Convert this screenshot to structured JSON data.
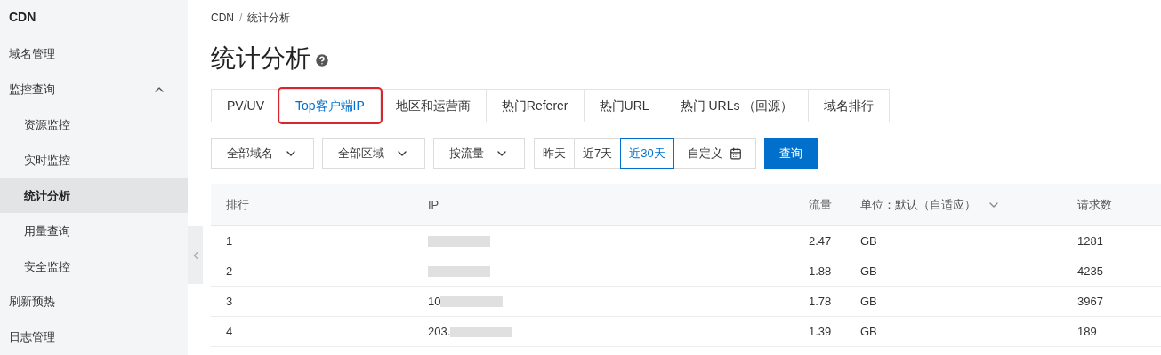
{
  "sidebar": {
    "title": "CDN",
    "items": [
      {
        "label": "域名管理",
        "selected": false
      },
      {
        "label": "监控查询",
        "selected": false,
        "expanded": true,
        "children": [
          {
            "label": "资源监控",
            "selected": false
          },
          {
            "label": "实时监控",
            "selected": false
          },
          {
            "label": "统计分析",
            "selected": true
          },
          {
            "label": "用量查询",
            "selected": false
          },
          {
            "label": "安全监控",
            "selected": false
          }
        ]
      },
      {
        "label": "刷新预热",
        "selected": false
      },
      {
        "label": "日志管理",
        "selected": false
      }
    ]
  },
  "breadcrumb": [
    "CDN",
    "统计分析"
  ],
  "breadcrumb_separator": "/",
  "page_title": "统计分析",
  "tabs": [
    {
      "label": "PV/UV",
      "selected": false,
      "highlighted": false
    },
    {
      "label": "Top客户端IP",
      "selected": true,
      "highlighted": true
    },
    {
      "label": "地区和运营商",
      "selected": false,
      "highlighted": false
    },
    {
      "label": "热门Referer",
      "selected": false,
      "highlighted": false
    },
    {
      "label": "热门URL",
      "selected": false,
      "highlighted": false
    },
    {
      "label": "热门 URLs （回源）",
      "selected": false,
      "highlighted": false
    },
    {
      "label": "域名排行",
      "selected": false,
      "highlighted": false
    }
  ],
  "filters": [
    "全部域名",
    "全部区域",
    "按流量"
  ],
  "date_ranges": [
    {
      "label": "昨天",
      "selected": false
    },
    {
      "label": "近7天",
      "selected": false
    },
    {
      "label": "近30天",
      "selected": true
    }
  ],
  "custom_range": "自定义",
  "query_button": "查询",
  "table": {
    "columns": [
      "排行",
      "IP",
      "流量",
      "单位：默认（自适应）",
      "请求数"
    ],
    "rows": [
      {
        "rank": "1",
        "traffic": "2.47",
        "unit": "GB",
        "requests": "1281"
      },
      {
        "rank": "2",
        "traffic": "1.88",
        "unit": "GB",
        "requests": "4235"
      },
      {
        "rank": "3",
        "ip": "10",
        "traffic": "1.78",
        "unit": "GB",
        "requests": "3967"
      },
      {
        "rank": "4",
        "ip": "203.",
        "traffic": "1.39",
        "unit": "GB",
        "requests": "189"
      }
    ]
  }
}
